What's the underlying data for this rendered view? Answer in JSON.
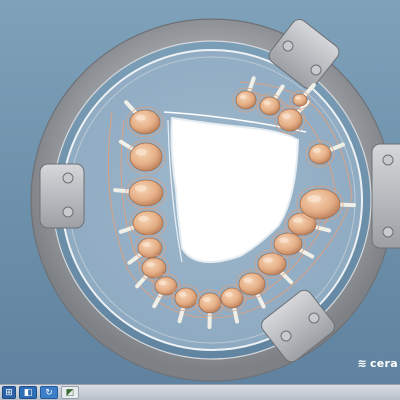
{
  "app": {
    "brand_text": "cera",
    "brand_mark_icon": "cerec-logo-icon"
  },
  "viewport": {
    "model": "full-denture-scan-model",
    "tray": "model-holder-ring",
    "tooth_count": 20
  },
  "taskbar": {
    "buttons": [
      {
        "name": "start-button",
        "icon": "windows-start-icon",
        "glyph": "⊞"
      },
      {
        "name": "taskbar-app-1",
        "icon": "app-window-icon",
        "glyph": "◧"
      },
      {
        "name": "taskbar-app-2",
        "icon": "sync-icon",
        "glyph": "↻"
      },
      {
        "name": "taskbar-app-3",
        "icon": "image-icon",
        "glyph": "◩"
      }
    ]
  },
  "colors": {
    "background": "#6f92ac",
    "ring": "#9a9da1",
    "tooth": "#e7b38c",
    "gum_outline": "#d9a183",
    "palate": "#ffffff",
    "connector": "#f0efe8"
  }
}
